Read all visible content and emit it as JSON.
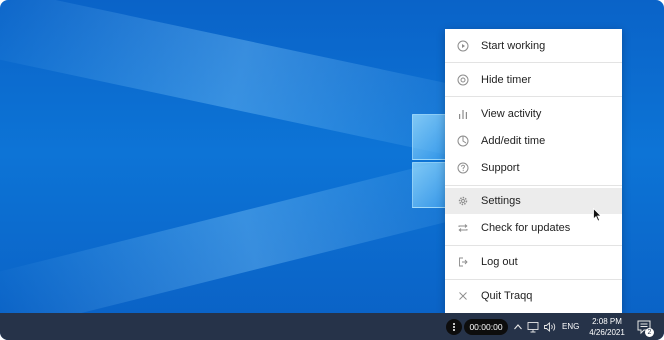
{
  "menu": {
    "items": [
      {
        "label": "Start working",
        "icon": "play-circle-icon"
      },
      {
        "label": "Hide timer",
        "icon": "eye-slash-icon"
      },
      {
        "label": "View activity",
        "icon": "bar-chart-icon"
      },
      {
        "label": "Add/edit time",
        "icon": "clock-icon"
      },
      {
        "label": "Support",
        "icon": "help-circle-icon"
      },
      {
        "label": "Settings",
        "icon": "gear-icon"
      },
      {
        "label": "Check for updates",
        "icon": "repeat-icon"
      },
      {
        "label": "Log out",
        "icon": "logout-icon"
      },
      {
        "label": "Quit Traqq",
        "icon": "close-icon"
      }
    ],
    "highlighted": "Settings"
  },
  "taskbar": {
    "timer": "00:00:00",
    "language": "ENG",
    "time": "2:08 PM",
    "date": "4/26/2021",
    "notification_count": "2"
  },
  "colors": {
    "taskbar": "#263349",
    "menu_bg": "#ffffff",
    "highlight": "#ececec",
    "desktop": "#0d74d6"
  }
}
